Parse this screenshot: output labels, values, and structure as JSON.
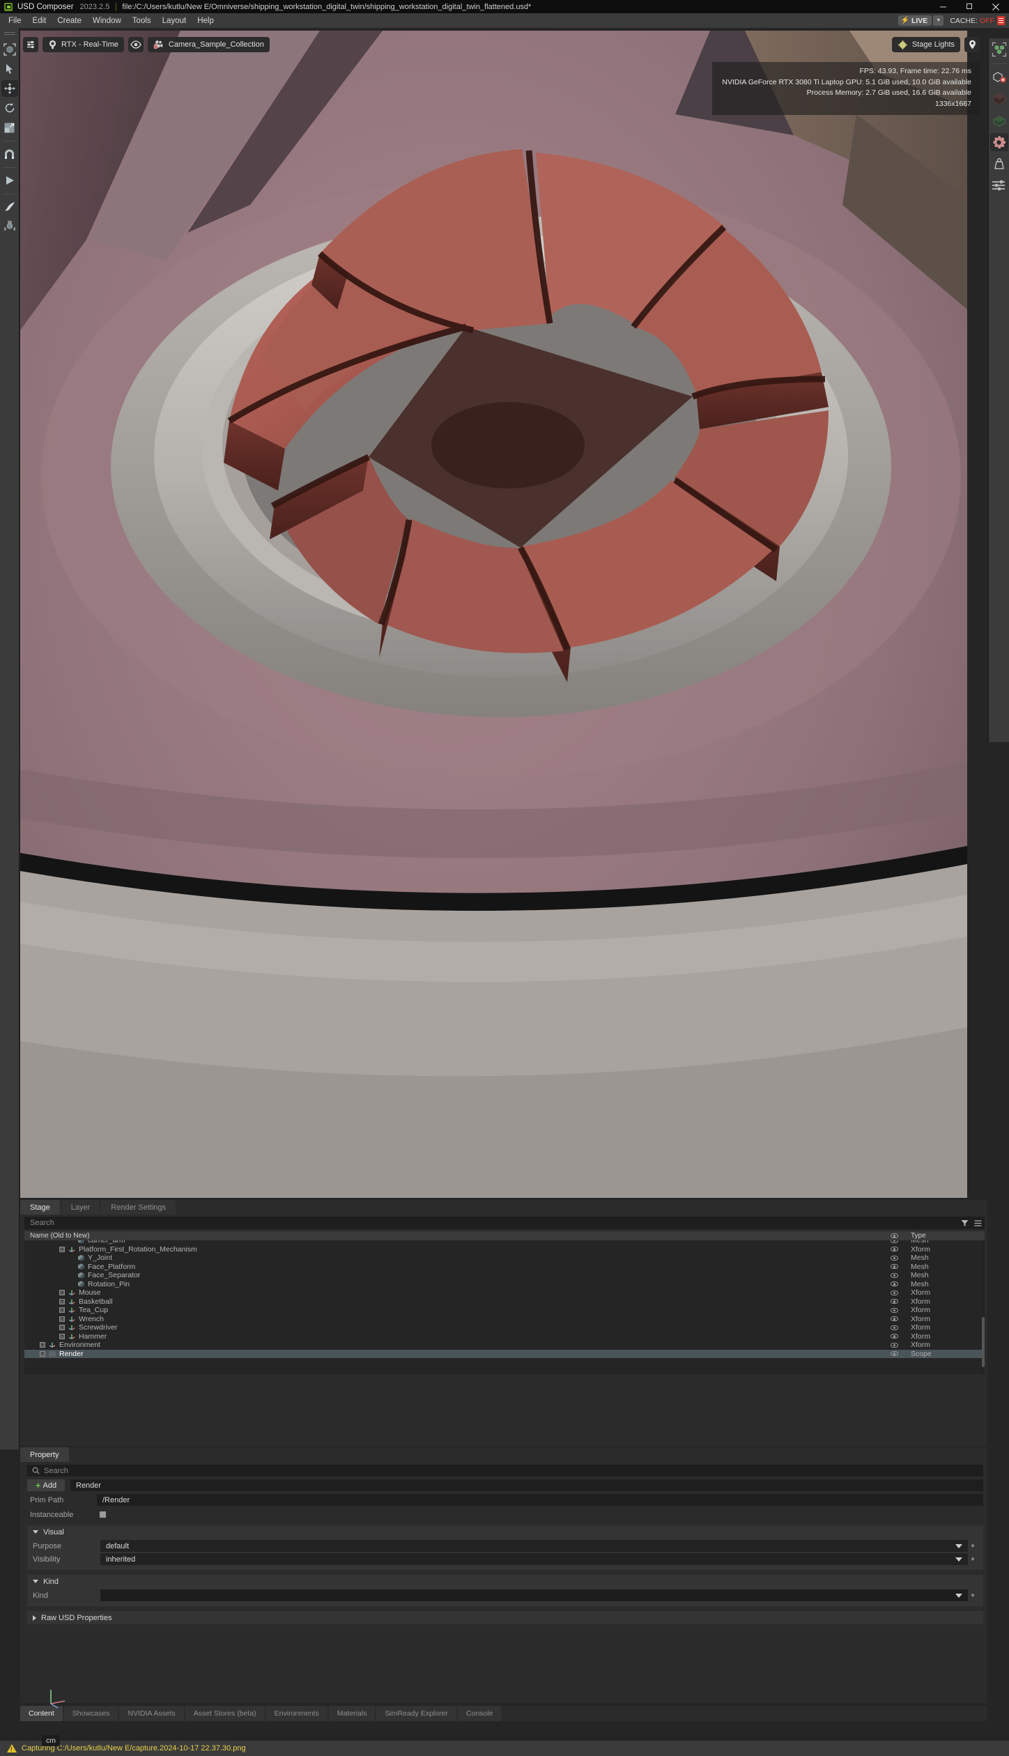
{
  "titlebar": {
    "app_name": "USD Composer",
    "version": "2023.2.5",
    "file_path": "file:/C:/Users/kutlu/New E/Omniverse/shipping_workstation_digital_twin/shipping_workstation_digital_twin_flattened.usd*",
    "minimize_label": "—",
    "maximize_label": "❐",
    "close_label": "✕"
  },
  "menubar": {
    "items": [
      "File",
      "Edit",
      "Create",
      "Window",
      "Tools",
      "Layout",
      "Help"
    ],
    "live_label": "LIVE",
    "live_bolt": "⚡",
    "cache_label": "CACHE:",
    "cache_value": "OFF"
  },
  "left_toolbar": {
    "items": [
      {
        "name": "selection-mode-icon",
        "label": "Select Mode"
      },
      {
        "name": "arrow-select-icon",
        "label": "Select"
      },
      {
        "name": "move-tool-icon",
        "label": "Move",
        "active": true
      },
      {
        "name": "rotate-tool-icon",
        "label": "Rotate"
      },
      {
        "name": "scale-tool-icon",
        "label": "Scale"
      },
      {
        "name": "snap-magnet-icon",
        "label": "Snap"
      },
      {
        "name": "play-icon",
        "label": "Play"
      },
      {
        "name": "paint-brush-icon",
        "label": "Paint"
      },
      {
        "name": "physics-drop-icon",
        "label": "Physics"
      }
    ]
  },
  "right_toolbar": {
    "items": [
      {
        "name": "multi-object-icon",
        "label": "Select Objects"
      },
      {
        "name": "hide-object-icon",
        "label": "Hide Object"
      },
      {
        "name": "dark-cube-icon",
        "label": "Dark Material"
      },
      {
        "name": "green-cube-icon",
        "label": "Green Material"
      },
      {
        "name": "gear-icon",
        "label": "Settings",
        "active": true
      },
      {
        "name": "weight-icon",
        "label": "Mass"
      },
      {
        "name": "sliders-icon",
        "label": "Adjust"
      }
    ]
  },
  "viewport": {
    "toolbar": {
      "settings_label": "",
      "renderer_label": "RTX - Real-Time",
      "visibility_label": "",
      "camera_label": "Camera_Sample_Collection"
    },
    "right_toolbar": {
      "lighting_label": "Stage Lights",
      "marker_label": ""
    },
    "hud": {
      "fps_line": "FPS: 43.93, Frame time: 22.76 ms",
      "gpu_line": "NVIDIA GeForce RTX 3080 Ti Laptop GPU: 5.1 GiB used, 10.0 GiB available",
      "memory_line": "Process Memory: 2.7 GiB used, 16.6 GiB available",
      "resolution_line": "1336x1667"
    },
    "unit_badge": "cm"
  },
  "stage_panel": {
    "tabs": [
      {
        "label": "Stage",
        "active": true
      },
      {
        "label": "Layer",
        "active": false
      },
      {
        "label": "Render Settings",
        "active": false
      }
    ],
    "search_placeholder": "Search",
    "columns": {
      "name": "Name (Old to New)",
      "type": "Type"
    },
    "rows": [
      {
        "label": "carrier_arm",
        "type": "Mesh",
        "indent": 4,
        "icon": "mesh",
        "expander": "none",
        "clipped": true,
        "selected": false
      },
      {
        "label": "Platform_First_Rotation_Mechanism",
        "type": "Xform",
        "indent": 3,
        "icon": "xform",
        "expander": "minus",
        "selected": false
      },
      {
        "label": "Y_Joint",
        "type": "Mesh",
        "indent": 4,
        "icon": "mesh",
        "expander": "none",
        "selected": false
      },
      {
        "label": "Face_Platform",
        "type": "Mesh",
        "indent": 4,
        "icon": "mesh",
        "expander": "none",
        "selected": false
      },
      {
        "label": "Face_Separator",
        "type": "Mesh",
        "indent": 4,
        "icon": "mesh",
        "expander": "none",
        "selected": false
      },
      {
        "label": "Rotation_Pin",
        "type": "Mesh",
        "indent": 4,
        "icon": "mesh",
        "expander": "none",
        "selected": false
      },
      {
        "label": "Mouse",
        "type": "Xform",
        "indent": 3,
        "icon": "xform",
        "expander": "plus",
        "selected": false
      },
      {
        "label": "Basketball",
        "type": "Xform",
        "indent": 3,
        "icon": "xform",
        "expander": "plus",
        "selected": false
      },
      {
        "label": "Tea_Cup",
        "type": "Xform",
        "indent": 3,
        "icon": "xform",
        "expander": "plus",
        "selected": false
      },
      {
        "label": "Wrench",
        "type": "Xform",
        "indent": 3,
        "icon": "xform",
        "expander": "plus",
        "selected": false
      },
      {
        "label": "Screwdriver",
        "type": "Xform",
        "indent": 3,
        "icon": "xform",
        "expander": "plus",
        "selected": false
      },
      {
        "label": "Hammer",
        "type": "Xform",
        "indent": 3,
        "icon": "xform",
        "expander": "plus",
        "selected": false
      },
      {
        "label": "Environment",
        "type": "Xform",
        "indent": 1,
        "icon": "xform",
        "expander": "plus",
        "selected": false
      },
      {
        "label": "Render",
        "type": "Scope",
        "indent": 1,
        "icon": "scope",
        "expander": "plus",
        "selected": true
      }
    ]
  },
  "property_panel": {
    "tab_label": "Property",
    "search_placeholder": "Search",
    "add_label": "Add",
    "name_value": "Render",
    "prim_path_label": "Prim Path",
    "prim_path_value": "/Render",
    "instanceable_label": "Instanceable",
    "groups": [
      {
        "title": "Visual",
        "expanded": true,
        "rows": [
          {
            "label": "Purpose",
            "value": "default",
            "dropdown": true
          },
          {
            "label": "Visibility",
            "value": "inherited",
            "dropdown": true
          }
        ]
      },
      {
        "title": "Kind",
        "expanded": true,
        "rows": [
          {
            "label": "Kind",
            "value": "",
            "dropdown": true
          }
        ]
      }
    ],
    "raw_usd_label": "Raw USD Properties"
  },
  "bottom_tabs": [
    {
      "label": "Content",
      "active": true
    },
    {
      "label": "Showcases",
      "active": false
    },
    {
      "label": "NVIDIA Assets",
      "active": false
    },
    {
      "label": "Asset Stores (beta)",
      "active": false
    },
    {
      "label": "Environments",
      "active": false
    },
    {
      "label": "Materials",
      "active": false
    },
    {
      "label": "SimReady Explorer",
      "active": false
    },
    {
      "label": "Console",
      "active": false
    }
  ],
  "statusbar": {
    "message": "Capturing C:/Users/kutlu/New E/capture.2024-10-17 22.37.30.png"
  },
  "colors": {
    "accent_green": "#8ec63f",
    "warning_yellow": "#e6d14a",
    "error_red": "#e03b2d",
    "selection_blue": "#4a5459",
    "panel_bg": "#2b2b2b",
    "viewport_bg": "#8a6f75"
  }
}
